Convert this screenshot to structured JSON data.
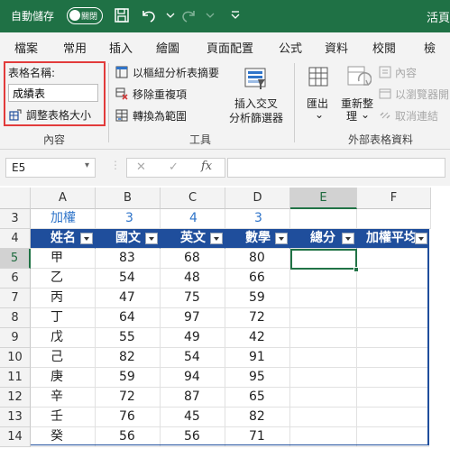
{
  "titlebar": {
    "autosave_label": "自動儲存",
    "toggle_state": "關閉",
    "filename": "活頁"
  },
  "tabs": [
    "檔案",
    "常用",
    "插入",
    "繪圖",
    "頁面配置",
    "公式",
    "資料",
    "校閱",
    "檢"
  ],
  "ribbon": {
    "properties": {
      "table_name_label": "表格名稱:",
      "table_name_value": "成績表",
      "resize_label": "調整表格大小",
      "group_label": "內容"
    },
    "tools": {
      "pivot_label": "以樞紐分析表摘要",
      "remove_dup_label": "移除重複項",
      "convert_label": "轉換為範圍",
      "slicer_label_1": "插入交叉",
      "slicer_label_2": "分析篩選器",
      "group_label": "工具"
    },
    "external": {
      "export_label": "匯出",
      "refresh_label_1": "重新整",
      "refresh_label_2": "理",
      "properties_label": "內容",
      "browser_label": "以瀏覽器開",
      "unlink_label": "取消連結",
      "group_label": "外部表格資料"
    }
  },
  "formula_bar": {
    "name_box": "E5",
    "cancel_icon": "✕",
    "confirm_icon": "✓",
    "fx_label": "fx",
    "formula": ""
  },
  "columns": [
    "A",
    "B",
    "C",
    "D",
    "E",
    "F"
  ],
  "rows": [
    "3",
    "4",
    "5",
    "6",
    "7",
    "8",
    "9",
    "10",
    "11",
    "12",
    "13",
    "14"
  ],
  "weights_row": {
    "label": "加權",
    "values": [
      "3",
      "4",
      "3"
    ]
  },
  "table_headers": [
    "姓名",
    "國文",
    "英文",
    "數學",
    "總分",
    "加權平均"
  ],
  "table_rows": [
    [
      "甲",
      "83",
      "68",
      "80"
    ],
    [
      "乙",
      "54",
      "48",
      "66"
    ],
    [
      "丙",
      "47",
      "75",
      "59"
    ],
    [
      "丁",
      "64",
      "97",
      "72"
    ],
    [
      "戊",
      "55",
      "49",
      "42"
    ],
    [
      "己",
      "82",
      "54",
      "91"
    ],
    [
      "庚",
      "59",
      "94",
      "95"
    ],
    [
      "辛",
      "72",
      "87",
      "65"
    ],
    [
      "壬",
      "76",
      "45",
      "82"
    ],
    [
      "癸",
      "56",
      "56",
      "71"
    ]
  ],
  "selected_cell": "E5",
  "colors": {
    "accent": "#1f7145",
    "table_header": "#1f4e9c",
    "weight_text": "#2f74c9",
    "highlight_box": "#e23b3b"
  }
}
